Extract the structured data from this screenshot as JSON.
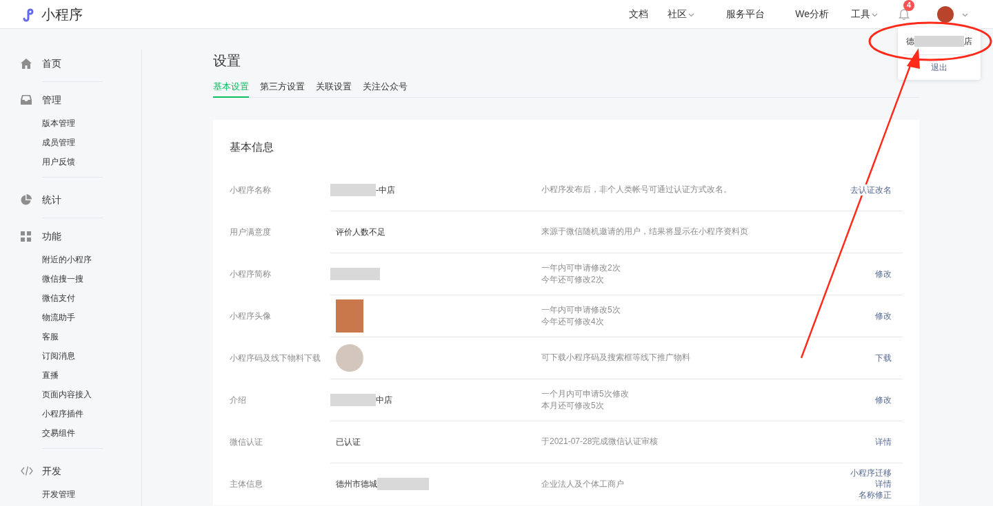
{
  "logo": {
    "title": "小程序"
  },
  "nav": [
    {
      "label": "文档",
      "dropdown": false
    },
    {
      "label": "社区",
      "dropdown": true
    },
    {
      "label": "服务平台",
      "dropdown": false
    },
    {
      "label": "We分析",
      "dropdown": false
    },
    {
      "label": "工具",
      "dropdown": true
    }
  ],
  "notifications": {
    "badge": "4"
  },
  "account_menu": {
    "name_start": "德",
    "name_end": "店",
    "logout": "退出"
  },
  "sidebar": [
    {
      "label": "首页"
    },
    {
      "label": "管理",
      "items": [
        "版本管理",
        "成员管理",
        "用户反馈"
      ]
    },
    {
      "label": "统计"
    },
    {
      "label": "功能",
      "items": [
        "附近的小程序",
        "微信搜一搜",
        "微信支付",
        "物流助手",
        "客服",
        "订阅消息",
        "直播",
        "页面内容接入",
        "小程序插件",
        "交易组件"
      ]
    },
    {
      "label": "开发",
      "items": [
        "开发管理"
      ]
    }
  ],
  "page": {
    "title": "设置"
  },
  "tabs": [
    {
      "label": "基本设置",
      "selected": true
    },
    {
      "label": "第三方设置",
      "selected": false
    },
    {
      "label": "关联设置",
      "selected": false
    },
    {
      "label": "关注公众号",
      "selected": false
    }
  ],
  "card": {
    "title": "基本信息"
  },
  "rows": [
    {
      "label": "小程序名称",
      "value": {
        "kind": "masked_before",
        "text": "-中店"
      },
      "desc": [
        "小程序发布后，非个人类帐号可通过认证方式改名。"
      ],
      "actions": [
        "去认证改名"
      ]
    },
    {
      "label": "用户满意度",
      "value": {
        "kind": "text",
        "text": "评价人数不足"
      },
      "desc": [
        "来源于微信随机邀请的用户，结果将显示在小程序资料页"
      ],
      "actions": []
    },
    {
      "label": "小程序简称",
      "value": {
        "kind": "masked"
      },
      "desc": [
        "一年内可申请修改2次",
        "今年还可修改2次"
      ],
      "actions": [
        "修改"
      ]
    },
    {
      "label": "小程序头像",
      "value": {
        "kind": "avatar"
      },
      "desc": [
        "一年内可申请修改5次",
        "今年还可修改4次"
      ],
      "actions": [
        "修改"
      ]
    },
    {
      "label": "小程序码及线下物料下载",
      "value": {
        "kind": "qr"
      },
      "desc": [
        "可下载小程序码及搜索框等线下推广物料"
      ],
      "actions": [
        "下载"
      ]
    },
    {
      "label": "介绍",
      "value": {
        "kind": "masked_before",
        "text": "中店"
      },
      "desc": [
        "一个月内可申请5次修改",
        "本月还可修改5次"
      ],
      "actions": [
        "修改"
      ]
    },
    {
      "label": "微信认证",
      "value": {
        "kind": "text",
        "text": "已认证"
      },
      "desc": [
        "于2021-07-28完成微信认证审核"
      ],
      "actions": [
        "详情"
      ]
    },
    {
      "label": "主体信息",
      "value": {
        "kind": "masked_after",
        "text": "德州市德城"
      },
      "desc": [
        "企业法人及个体工商户"
      ],
      "actions": [
        "小程序迁移",
        "详情",
        "名称修正"
      ]
    }
  ]
}
